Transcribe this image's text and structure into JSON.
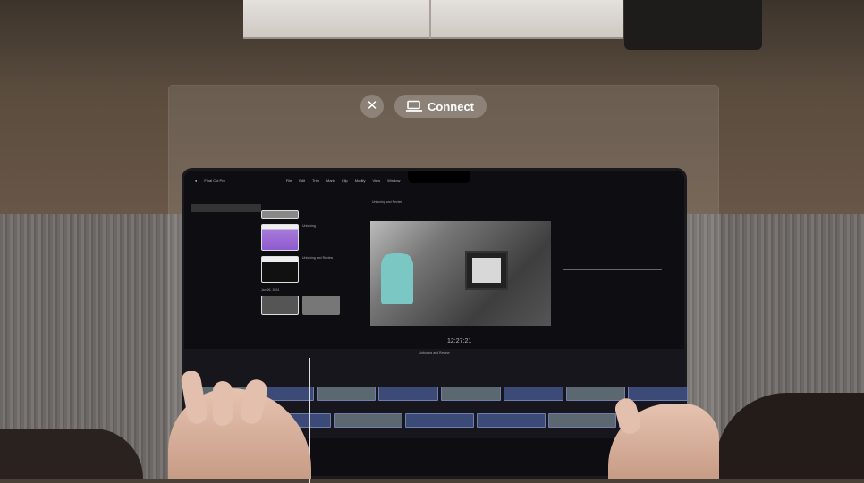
{
  "controls": {
    "close_icon": "xmark",
    "connect_label": "Connect",
    "connect_icon": "mac-virtual-display-icon"
  },
  "laptop": {
    "app_name": "Final Cut Pro",
    "menu": [
      "File",
      "Edit",
      "Trim",
      "Mark",
      "Clip",
      "Modify",
      "View",
      "Window"
    ],
    "browser": {
      "clips": [
        "Unboxing",
        "Unboxing and Review"
      ],
      "date_group": "Jan 26, 2024"
    },
    "viewer_title": "Unboxing and Review",
    "timecode": "12:27:21",
    "timeline_title": "Unboxing and Review"
  }
}
